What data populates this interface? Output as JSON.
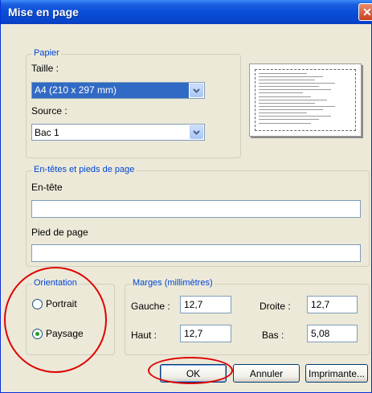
{
  "window": {
    "title": "Mise en page",
    "close_glyph": "✕"
  },
  "paper": {
    "legend": "Papier",
    "size_label": "Taille :",
    "size_value": "A4 (210 x 297 mm)",
    "source_label": "Source :",
    "source_value": "Bac 1"
  },
  "headers": {
    "legend": "En-têtes et pieds de page",
    "header_label": "En-tête",
    "header_value": "",
    "footer_label": "Pied de page",
    "footer_value": ""
  },
  "orientation": {
    "legend": "Orientation",
    "portrait_label": "Portrait",
    "landscape_label": "Paysage",
    "selected": "Paysage"
  },
  "margins": {
    "legend": "Marges (millimètres)",
    "left_label": "Gauche :",
    "left_value": "12,7",
    "right_label": "Droite :",
    "right_value": "12,7",
    "top_label": "Haut :",
    "top_value": "12,7",
    "bottom_label": "Bas :",
    "bottom_value": "5,08"
  },
  "buttons": {
    "ok": "OK",
    "cancel": "Annuler",
    "printer": "Imprimante..."
  },
  "colors": {
    "title_bar": "#0a4ed8",
    "legend_text": "#0046d5",
    "annotation": "#e00000",
    "radio_dot": "#21a121"
  },
  "icons": {
    "close": "close-icon",
    "dropdown": "chevron-down-icon"
  }
}
